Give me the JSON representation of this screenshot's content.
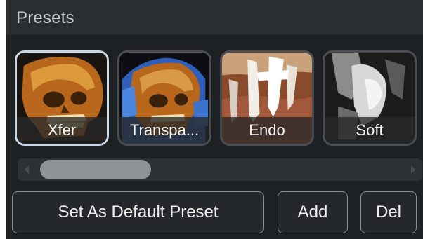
{
  "panel": {
    "title": "Presets"
  },
  "presets": [
    {
      "label": "Xfer",
      "selected": true
    },
    {
      "label": "Transpa...",
      "selected": false
    },
    {
      "label": "Endo",
      "selected": false
    },
    {
      "label": "Soft",
      "selected": false
    }
  ],
  "scrollbar": {
    "position": 0.0
  },
  "buttons": {
    "set_default": "Set As Default Preset",
    "add": "Add",
    "del": "Del"
  },
  "colors": {
    "panel_bg": "#1e2124",
    "header_bg": "#2b2e31",
    "selected_border": "#c7d7e6",
    "button_border": "#8c9094"
  }
}
